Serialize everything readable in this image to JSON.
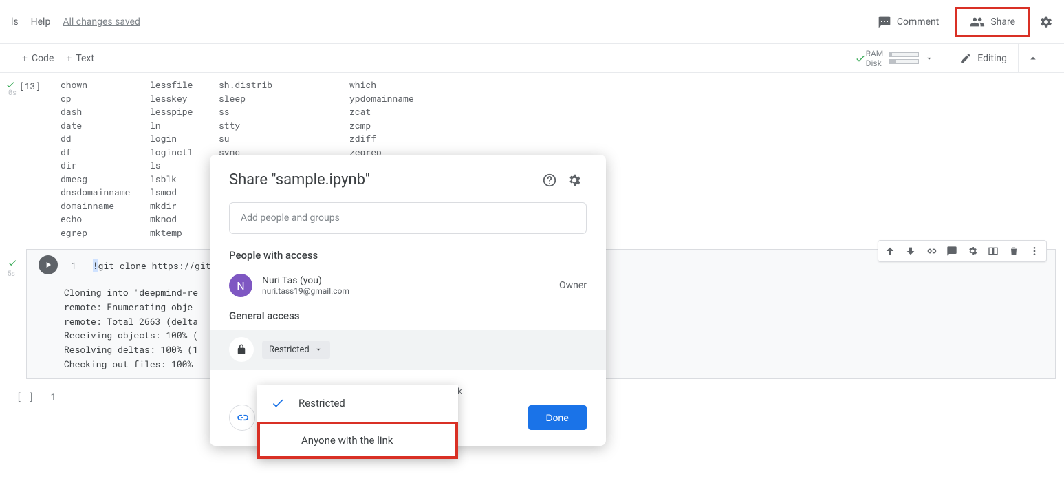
{
  "menu": {
    "tools": "ls",
    "help": "Help",
    "saved": "All changes saved"
  },
  "topbar": {
    "comment": "Comment",
    "share": "Share"
  },
  "toolbar": {
    "code": "Code",
    "text": "Text",
    "ram": "RAM",
    "disk": "Disk",
    "editing": "Editing"
  },
  "cell1": {
    "prompt": "[13]",
    "time": "0s",
    "cols": {
      "a": [
        "chown",
        "cp",
        "dash",
        "date",
        "dd",
        "df",
        "dir",
        "dmesg",
        "dnsdomainname",
        "domainname",
        "echo",
        "egrep"
      ],
      "b": [
        "lessfile",
        "lesskey",
        "lesspipe",
        "ln",
        "login",
        "loginctl",
        "ls",
        "lsblk",
        "lsmod",
        "mkdir",
        "mknod",
        "mktemp"
      ],
      "c": [
        "sh.distrib",
        "sleep",
        "ss",
        "stty",
        "su",
        "sync",
        "",
        "",
        "",
        "",
        "",
        ""
      ],
      "d": [
        "which",
        "ypdomainname",
        "zcat",
        "zcmp",
        "zdiff",
        "zegrep",
        "",
        "",
        "",
        "",
        "",
        ""
      ]
    }
  },
  "cell2": {
    "time": "5s",
    "line_no": "1",
    "bang": "!",
    "cmd": "git clone ",
    "url": "https://git",
    "out": [
      "Cloning into 'deepmind-re",
      "remote: Enumerating obje",
      "remote: Total 2663 (delta",
      "Receiving objects: 100% (",
      "Resolving deltas: 100% (1",
      "Checking out files: 100% "
    ]
  },
  "cell3": {
    "brackets": "[ ]",
    "lineno": "1"
  },
  "share": {
    "title": "Share \"sample.ipynb\"",
    "placeholder": "Add people and groups",
    "people_title": "People with access",
    "person": {
      "initial": "N",
      "name": "Nuri Tas (you)",
      "email": "nuri.tass19@gmail.com",
      "role": "Owner"
    },
    "general_title": "General access",
    "restricted": "Restricted",
    "nk": "nk",
    "options": {
      "restricted": "Restricted",
      "anyone": "Anyone with the link"
    },
    "done": "Done"
  }
}
